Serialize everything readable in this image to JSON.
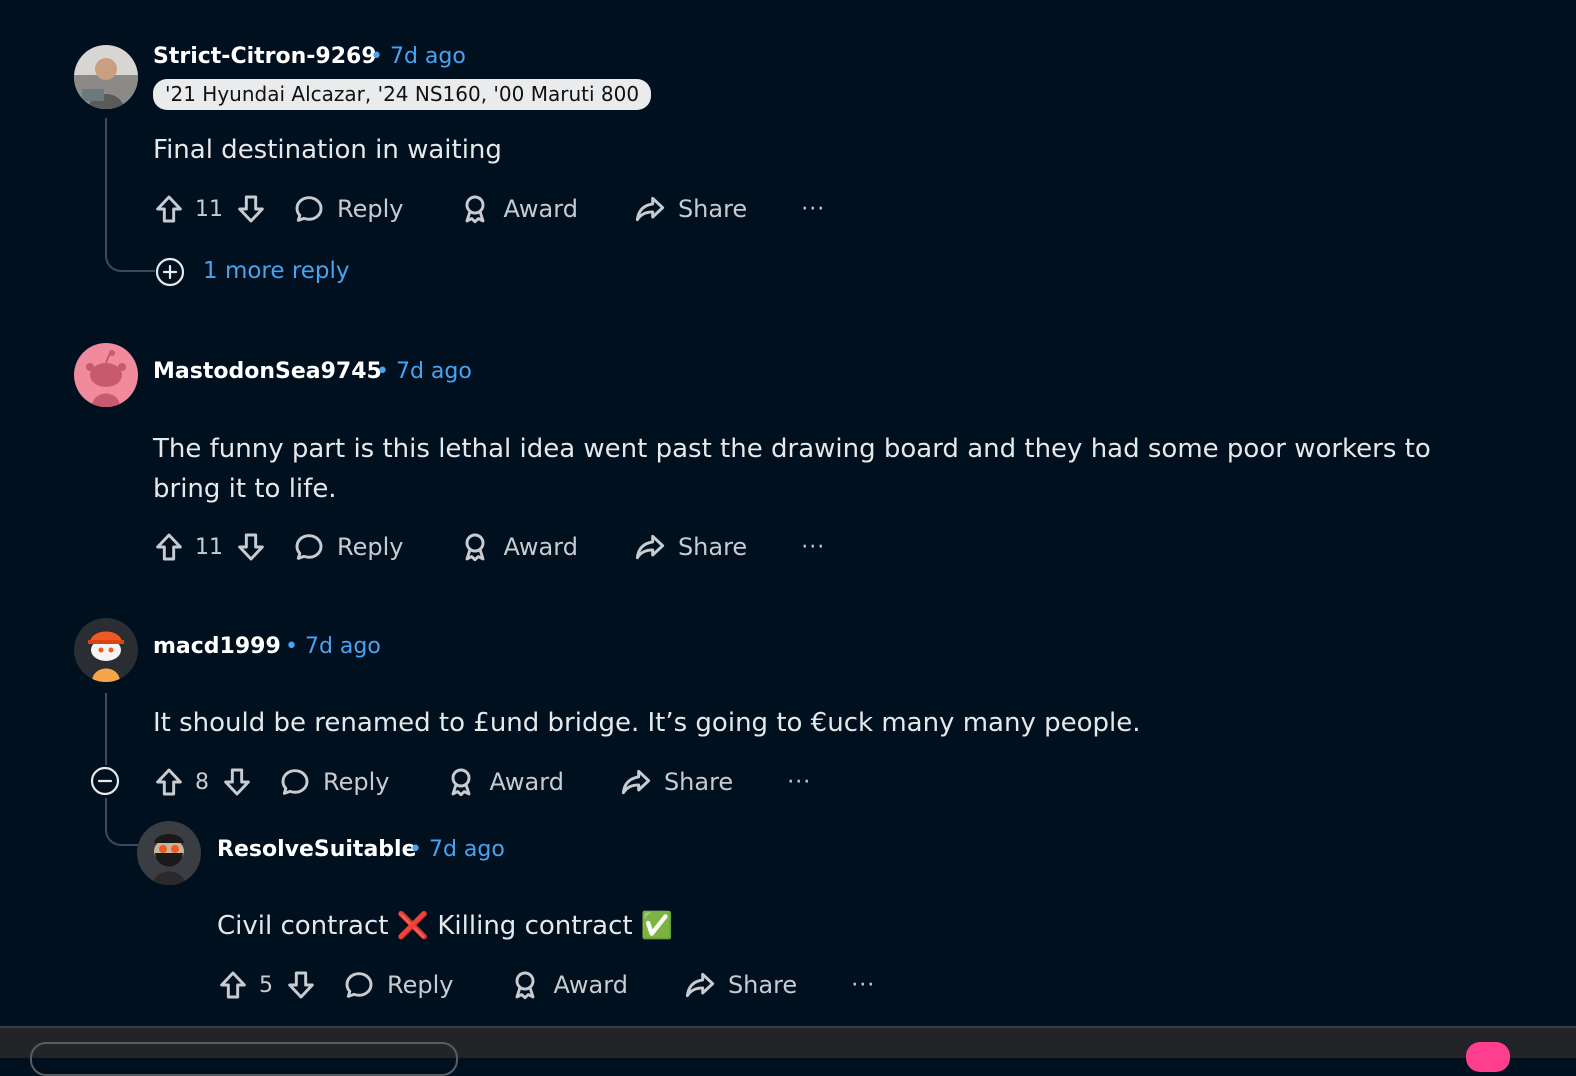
{
  "colors": {
    "background": "#01101f",
    "link": "#4aa3f0",
    "author": "#ffffff",
    "text": "#e6e8ea"
  },
  "comments": [
    {
      "author": "Strict-Citron-9269",
      "time": "• 7d ago",
      "flair": "'21 Hyundai Alcazar, '24 NS160, '00 Maruti 800",
      "body": "Final destination in waiting",
      "votes": "11",
      "reply_label": "Reply",
      "award_label": "Award",
      "share_label": "Share",
      "more_replies": "1 more reply",
      "avatar_icon": "avatar-photo"
    },
    {
      "author": "MastodonSea9745",
      "time": "• 7d ago",
      "body": "The funny part is this lethal idea went past the drawing board and they had some poor workers to bring it to life.",
      "votes": "11",
      "reply_label": "Reply",
      "award_label": "Award",
      "share_label": "Share",
      "avatar_icon": "snoo-default-avatar"
    },
    {
      "author": "macd1999",
      "time": "• 7d ago",
      "body": "It should be renamed to £und bridge. It’s going to €uck many many people.",
      "votes": "8",
      "reply_label": "Reply",
      "award_label": "Award",
      "share_label": "Share",
      "avatar_icon": "snoo-hardhat-avatar"
    },
    {
      "author": "ResolveSuitable",
      "time": "• 7d ago",
      "body_part1": "Civil contract",
      "emoji1": "❌",
      "body_part2": "Killing contract",
      "emoji2": "✅",
      "votes": "5",
      "reply_label": "Reply",
      "award_label": "Award",
      "share_label": "Share",
      "avatar_icon": "snoo-bearded-sunglasses-avatar"
    }
  ],
  "more_menu": "···"
}
